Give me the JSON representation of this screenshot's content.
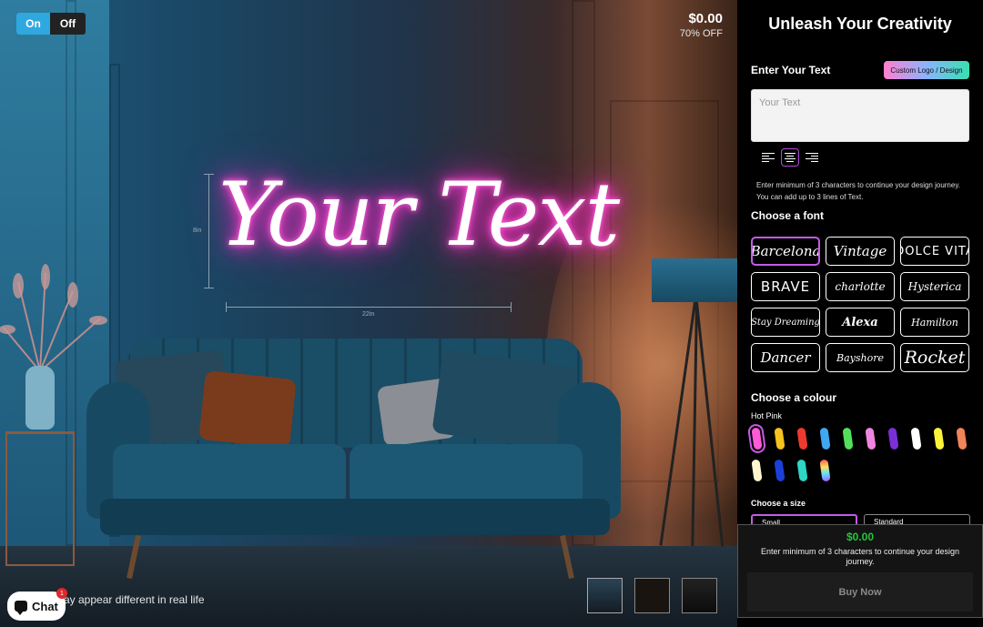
{
  "toggle": {
    "on_label": "On",
    "off_label": "Off",
    "selected": "On"
  },
  "price": {
    "amount": "$0.00",
    "discount": "70% OFF"
  },
  "preview": {
    "neon_text": "Your Text",
    "height_label": "8in",
    "width_label": "22in",
    "disclaimer": "ay appear different in real life"
  },
  "chat": {
    "label": "Chat",
    "badge": "1"
  },
  "thumbnails": [
    {
      "name": "room-scene"
    },
    {
      "name": "dark-scene"
    },
    {
      "name": "product-scene"
    }
  ],
  "sidebar": {
    "title": "Unleash Your Creativity",
    "enter_text_label": "Enter Your Text",
    "custom_logo_button": "Custom Logo / Design",
    "text_placeholder": "Your Text",
    "alignment": {
      "options": [
        "left",
        "center",
        "right"
      ],
      "selected": "center"
    },
    "hint_line1": "Enter minimum of 3 characters to continue your design journey.",
    "hint_line2": "You can add up to 3 lines of Text.",
    "font_label": "Choose a font",
    "fonts": [
      {
        "label": "Barcelona",
        "selected": true
      },
      {
        "label": "Vintage",
        "selected": false
      },
      {
        "label": "DOLCE VITA",
        "selected": false
      },
      {
        "label": "BRAVE",
        "selected": false
      },
      {
        "label": "charlotte",
        "selected": false
      },
      {
        "label": "Hysterica",
        "selected": false
      },
      {
        "label": "Stay Dreaming",
        "selected": false
      },
      {
        "label": "Alexa",
        "selected": false
      },
      {
        "label": "Hamilton",
        "selected": false
      },
      {
        "label": "Dancer",
        "selected": false
      },
      {
        "label": "Bayshore",
        "selected": false
      },
      {
        "label": "Rocket",
        "selected": false
      }
    ],
    "colour_label": "Choose a colour",
    "colour_name": "Hot Pink",
    "colours": [
      "#ff5ad8",
      "#f5c21e",
      "#ee3a2e",
      "#3fa7f0",
      "#53e05a",
      "#ee86e0",
      "#7a2fd8",
      "#ffffff",
      "#fff23a",
      "#f0845a",
      "#fff6d0",
      "#1c3fd8",
      "#2fd6c4",
      "#rainbow"
    ],
    "selected_colour": 0,
    "size_label": "Choose a size",
    "sizes": [
      "Small",
      "Standard"
    ],
    "selected_size": "Small"
  },
  "buy": {
    "amount": "$0.00",
    "message": "Enter minimum of 3 characters to continue your design journey.",
    "button_label": "Buy Now"
  }
}
